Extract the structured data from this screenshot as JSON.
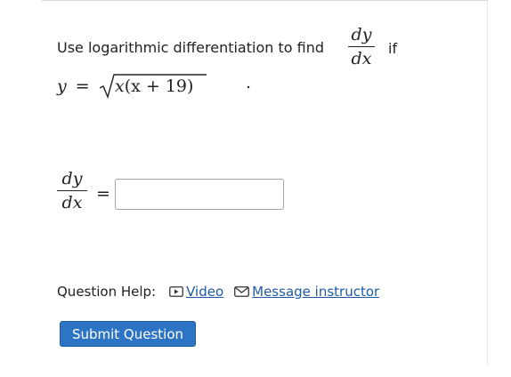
{
  "question": {
    "prompt_text": "Use logarithmic differentiation to find",
    "derivative_numerator": "dy",
    "derivative_denominator": "dx",
    "if_word": "if",
    "equation_lhs": "y",
    "equation_equals": "=",
    "radicand_var": "x",
    "radicand_rest": "(x + 19)",
    "equation_end": "."
  },
  "answer": {
    "lhs_numerator": "dy",
    "lhs_denominator": "dx",
    "equals": "=",
    "value": "",
    "placeholder": ""
  },
  "help": {
    "label": "Question Help:",
    "video_label": "Video",
    "message_label": "Message instructor"
  },
  "submit_label": "Submit Question",
  "colors": {
    "link": "#1d5ba6",
    "button": "#2d74c4",
    "text": "#222222"
  }
}
